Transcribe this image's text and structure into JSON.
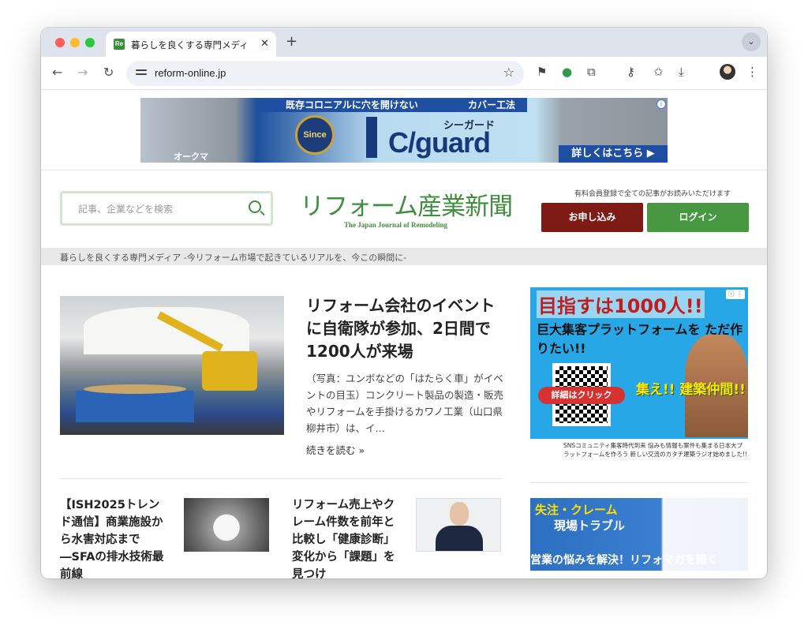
{
  "browser": {
    "tab_title": "暮らしを良くする専門メディア -",
    "tab_favicon": "Re",
    "tab_close": "✕",
    "new_tab": "+",
    "tab_menu": "⌄",
    "url": "reform-online.jp",
    "icons": [
      "back-icon",
      "forward-icon",
      "reload-icon",
      "site-info-icon",
      "bookmark-star-icon",
      "extension-icon",
      "password-key-icon",
      "download-icon",
      "profile-avatar",
      "menu-icon"
    ]
  },
  "ad_top": {
    "headline": "既存コロニアルに穴を開けない",
    "method": "カバー工法",
    "seal": "Since 2015",
    "sub": "シーガード",
    "brand": "C/guard",
    "cta": "詳しくはこちら ▶",
    "maker": "オークマ",
    "info": "i"
  },
  "header": {
    "search_placeholder": "記事、企業などを検索",
    "logo_jp": "リフォーム産業新聞",
    "logo_en": "The Japan Journal of Remodeling",
    "members_note": "有料会員登録で全ての記事がお読みいただけます",
    "apply_label": "お申し込み",
    "login_label": "ログイン"
  },
  "tagline": "暮らしを良くする専門メディア -今リフォーム市場で起きているリアルを、今この瞬間に-",
  "hero": {
    "title": "リフォーム会社のイベントに自衛隊が参加、2日間で1200人が来場",
    "excerpt": "（写真：ユンボなどの「はたらく車」がイベントの目玉）コンクリート製品の製造・販売やリフォームを手掛けるカワノ工業（山口県柳井市）は、イ…",
    "read_more": "続きを読む »"
  },
  "cards": [
    {
      "title": "【ISH2025トレンド通信】商業施設から水害対応まで―SFAの排水技術最前線"
    },
    {
      "title": "リフォーム売上やクレーム件数を前年と比較し「健康診断」 変化から「課題」を見つけ"
    }
  ],
  "side_ad1": {
    "title": "目指すは1000人!!",
    "subtitle": "巨大集客プラットフォームを ただ作りたい!!",
    "click": "詳細はクリック",
    "cta": "集え!! 建築仲間!!",
    "footer": "SNSコミュニティ集客時代到来 悩みも情報も案件も集まる日本大プラットフォームを作ろう 新しい交流のカタチ建築ラジオ始めました!!",
    "info": "ⓘ ⋮"
  },
  "side_ad2": {
    "line1": "失注・クレーム",
    "line2": "現場トラブル",
    "line3": "営業の悩みを解決！リフォマガを開く"
  }
}
